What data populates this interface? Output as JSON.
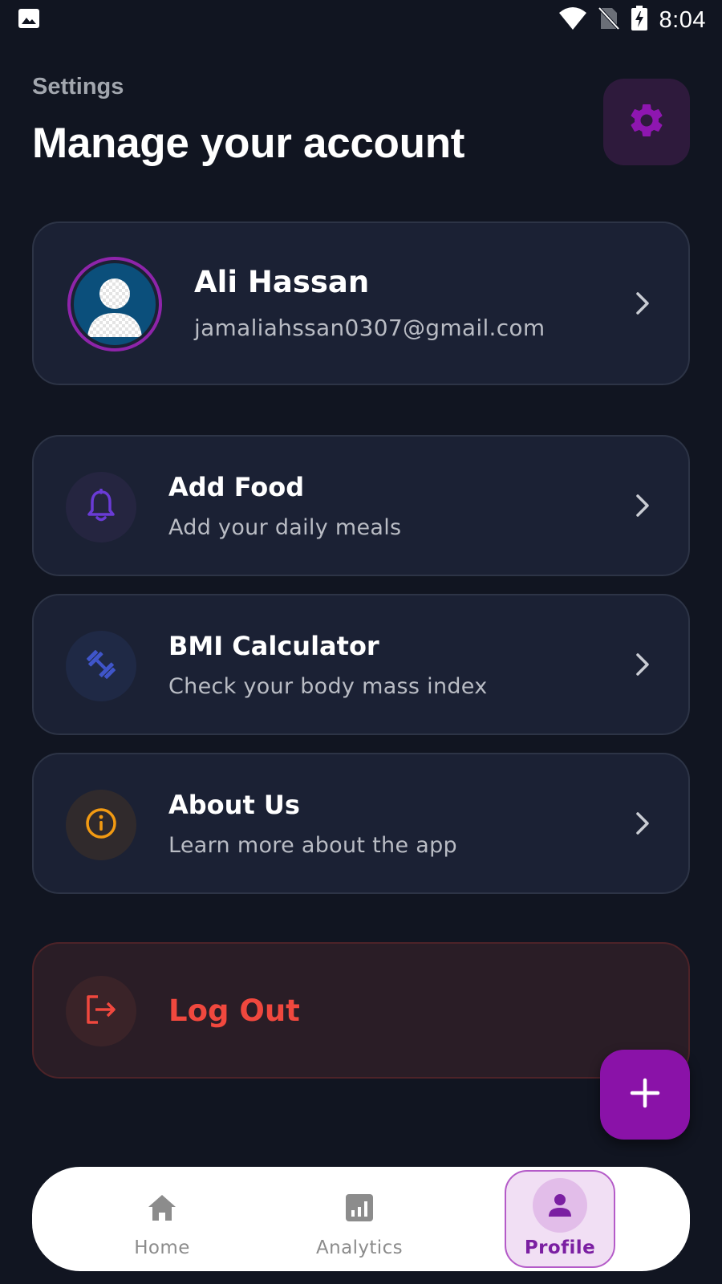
{
  "status_bar": {
    "time": "8:04",
    "icons": [
      "image-icon",
      "wifi-icon",
      "no-sim-icon",
      "battery-charging-icon"
    ]
  },
  "header": {
    "eyebrow": "Settings",
    "title": "Manage your account",
    "settings_icon": "gear-icon"
  },
  "profile": {
    "name": "Ali Hassan",
    "email": "jamaliahssan0307@gmail.com",
    "avatar_icon": "avatar-placeholder-icon"
  },
  "menu": [
    {
      "title": "Add Food",
      "subtitle": "Add your daily meals",
      "icon": "bell-icon",
      "icon_color": "#6a3bd6",
      "circle_color": "#252540"
    },
    {
      "title": "BMI Calculator",
      "subtitle": "Check your body mass index",
      "icon": "dumbbell-icon",
      "icon_color": "#3f55c9",
      "circle_color": "#1f2945"
    },
    {
      "title": "About Us",
      "subtitle": "Learn more about the app",
      "icon": "info-icon",
      "icon_color": "#f29a12",
      "circle_color": "#302a2c"
    }
  ],
  "logout": {
    "label": "Log Out",
    "icon": "logout-icon",
    "color": "#f0483e"
  },
  "fab": {
    "icon": "plus-icon",
    "color": "#8a12a8"
  },
  "nav": {
    "items": [
      {
        "label": "Home",
        "icon": "home-icon"
      },
      {
        "label": "Analytics",
        "icon": "analytics-icon"
      },
      {
        "label": "Profile",
        "icon": "person-icon"
      }
    ],
    "active": "Profile"
  },
  "colors": {
    "background": "#111521",
    "card": "#1b2134",
    "accent": "#8e24aa"
  }
}
